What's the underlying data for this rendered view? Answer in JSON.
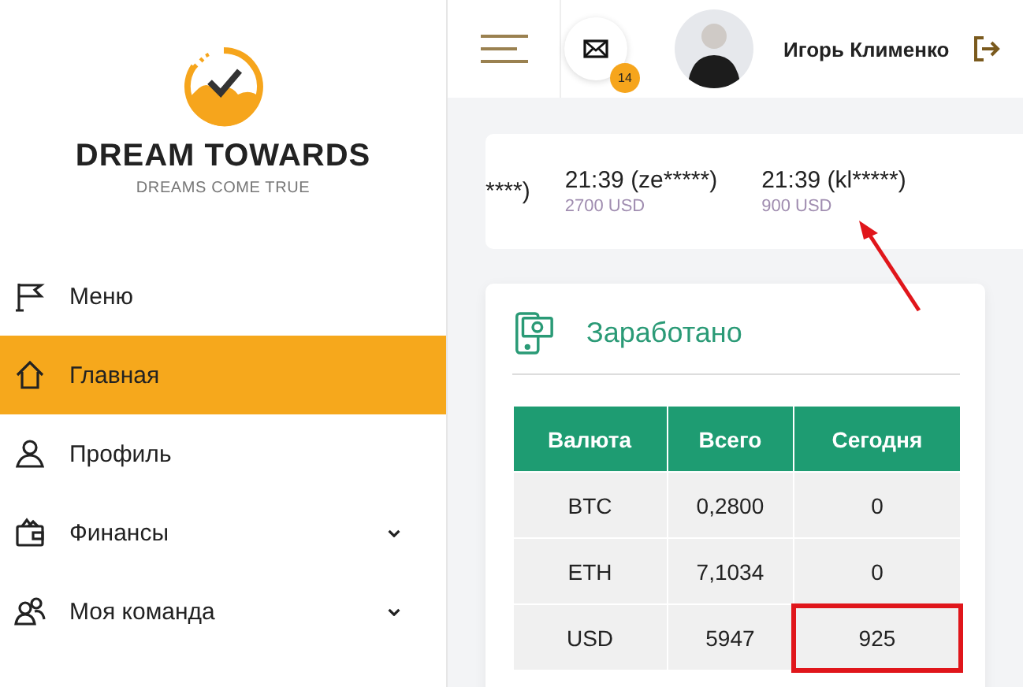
{
  "brand": {
    "name": "DREAM TOWARDS",
    "tagline": "DREAMS COME TRUE"
  },
  "sidebar": {
    "items": [
      {
        "label": "Меню",
        "selected": false,
        "expandable": false
      },
      {
        "label": "Главная",
        "selected": true,
        "expandable": false
      },
      {
        "label": "Профиль",
        "selected": false,
        "expandable": false
      },
      {
        "label": "Финансы",
        "selected": false,
        "expandable": true
      },
      {
        "label": "Моя команда",
        "selected": false,
        "expandable": true
      }
    ]
  },
  "header": {
    "mail_badge": "14",
    "user_name": "Игорь Клименко"
  },
  "ticker": [
    {
      "title": "****)",
      "annotated": false
    },
    {
      "title": "21:39 (ze*****)",
      "amount": "2700 USD",
      "annotated": false
    },
    {
      "title": "21:39 (kl*****)",
      "amount": "900 USD",
      "annotated": true
    }
  ],
  "earned": {
    "title": "Заработано",
    "table": {
      "columns": [
        "Валюта",
        "Всего",
        "Сегодня"
      ],
      "rows": [
        [
          {
            "text": "BTC",
            "highlighted": false
          },
          {
            "text": "0,2800",
            "highlighted": false
          },
          {
            "text": "0",
            "highlighted": false
          }
        ],
        [
          {
            "text": "ETH",
            "highlighted": false
          },
          {
            "text": "7,1034",
            "highlighted": false
          },
          {
            "text": "0",
            "highlighted": false
          }
        ],
        [
          {
            "text": "USD",
            "highlighted": false
          },
          {
            "text": "5947",
            "highlighted": false
          },
          {
            "text": "925",
            "highlighted": true
          }
        ]
      ]
    }
  }
}
